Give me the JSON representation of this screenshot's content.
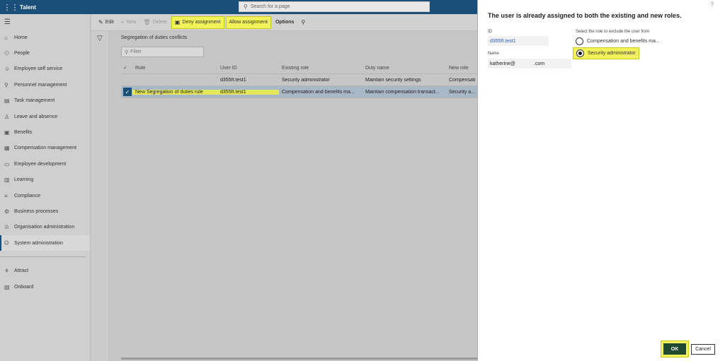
{
  "app": {
    "title": "Talent"
  },
  "search": {
    "placeholder": "Search for a page"
  },
  "toolbar": {
    "edit": "Edit",
    "new": "New",
    "delete": "Delete",
    "deny": "Deny assignment",
    "allow": "Allow assignment",
    "options": "Options"
  },
  "nav": {
    "items": [
      {
        "label": "Home",
        "icon": "home-icon",
        "glyph": "⌂"
      },
      {
        "label": "People",
        "icon": "people-icon",
        "glyph": "⚇"
      },
      {
        "label": "Employee self service",
        "icon": "person-icon",
        "glyph": "☺"
      },
      {
        "label": "Personnel management",
        "icon": "personnel-icon",
        "glyph": "⚲"
      },
      {
        "label": "Task management",
        "icon": "clipboard-icon",
        "glyph": "▤"
      },
      {
        "label": "Leave and absence",
        "icon": "leave-icon",
        "glyph": "♙"
      },
      {
        "label": "Benefits",
        "icon": "benefits-icon",
        "glyph": "▣"
      },
      {
        "label": "Compensation management",
        "icon": "compensation-icon",
        "glyph": "▦"
      },
      {
        "label": "Employee development",
        "icon": "development-icon",
        "glyph": "▭"
      },
      {
        "label": "Learning",
        "icon": "learning-icon",
        "glyph": "▥"
      },
      {
        "label": "Compliance",
        "icon": "compliance-icon",
        "glyph": "≡"
      },
      {
        "label": "Business processes",
        "icon": "process-icon",
        "glyph": "⚙"
      },
      {
        "label": "Organisation administration",
        "icon": "org-icon",
        "glyph": "♔"
      },
      {
        "label": "System administration",
        "icon": "system-icon",
        "glyph": "⛭"
      }
    ],
    "secondary": [
      {
        "label": "Attract",
        "icon": "attract-icon",
        "glyph": "⚘"
      },
      {
        "label": "Onboard",
        "icon": "onboard-icon",
        "glyph": "▧"
      }
    ]
  },
  "content": {
    "section_title": "Segregation of duties conflicts",
    "filter_placeholder": "Filter",
    "columns": [
      "Rule",
      "User ID",
      "Existing role",
      "Duty name",
      "New role"
    ],
    "rows": [
      {
        "rule": "",
        "user_id": "d355ft.test1",
        "existing_role": "Security administrator",
        "duty_name": "Maintain security settings",
        "new_role": "Compensati"
      },
      {
        "rule": "New Segregation of duties rule",
        "user_id": "d355ft.test1",
        "existing_role": "Compensation and benefits ma...",
        "duty_name": "Maintain compensation transact...",
        "new_role": "Security adm"
      }
    ]
  },
  "panel": {
    "help": "?",
    "title": "The user is already assigned to both the existing and new roles.",
    "id_label": "ID",
    "id_value": "d355ft.test1",
    "name_label": "Name",
    "name_value": "katherine@",
    "name_suffix": ".com",
    "role_prompt": "Select the role to exclude the user from",
    "role_options": [
      "Compensation and benefits ma...",
      "Security administrator"
    ],
    "selected_role": 1,
    "ok": "OK",
    "cancel": "Cancel"
  },
  "colors": {
    "topbar": "#1a4f7a",
    "highlight": "#f2f25a",
    "ok_button": "#1f4a2f"
  }
}
